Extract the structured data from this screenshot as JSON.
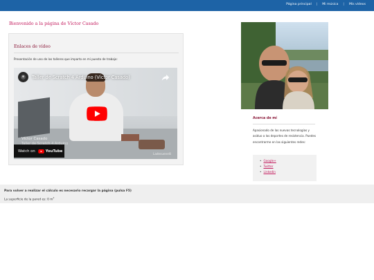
{
  "nav": {
    "items": [
      {
        "label": "Página principal"
      },
      {
        "label": "Mi música"
      },
      {
        "label": "Mis vídeos"
      }
    ],
    "separator": "|"
  },
  "page": {
    "title": "Bienvenido a la página de Víctor Casado"
  },
  "videos": {
    "heading": "Enlaces de vídeo",
    "description": "Presentación de uno de los talleres que imparto en mi puesto de trabajo:",
    "embed": {
      "video_title": "Taller de Scratch 4 Arduino (Víctor Casado)",
      "overlay_name": "Víctor Casado",
      "overlay_subtitle": "Taller de Scratch 4 Arduino",
      "watch_on": "Watch on",
      "youtube_logo": "YouTube",
      "watermark": "Ladesuenelli",
      "play_icon": "play-icon",
      "share_icon": "share-icon",
      "colors": {
        "play": "#ff0000"
      }
    }
  },
  "about": {
    "title": "Acerca de mí",
    "text": "Apasionado de las nuevas tecnologías y asiduo a los deportes de resistencia. Puedes encontrarme en las siguientes redes:",
    "links": [
      {
        "label": "Google+"
      },
      {
        "label": "Twitter"
      },
      {
        "label": "Linkedin"
      }
    ]
  },
  "footer": {
    "notice": "Para volver a realizar el cálculo es necesario recargar la página (pulsa F5)",
    "area_text": "La superficie de la pared es: 0 m",
    "area_exponent": "2"
  },
  "colors": {
    "topbar": "#1d63a6",
    "accent": "#c2185b",
    "heading": "#8b1a3a"
  }
}
